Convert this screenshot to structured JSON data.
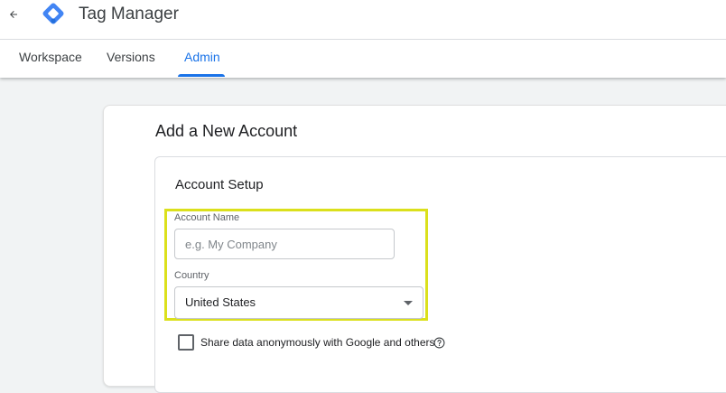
{
  "header": {
    "app_title": "Tag Manager",
    "back_icon": "arrow-left-icon",
    "logo_icon": "tag-manager-logo-icon",
    "accent_color": "#1a73e8"
  },
  "tabs": [
    {
      "label": "Workspace",
      "active": false
    },
    {
      "label": "Versions",
      "active": false
    },
    {
      "label": "Admin",
      "active": true
    }
  ],
  "page": {
    "title": "Add a New Account",
    "section_title": "Account Setup",
    "account_name": {
      "label": "Account Name",
      "value": "",
      "placeholder": "e.g. My Company"
    },
    "country": {
      "label": "Country",
      "value": "United States"
    },
    "share_data": {
      "label": "Share data anonymously with Google and others",
      "checked": false,
      "help_icon": "help-circle-icon"
    },
    "highlight_color": "#dbe01c"
  }
}
